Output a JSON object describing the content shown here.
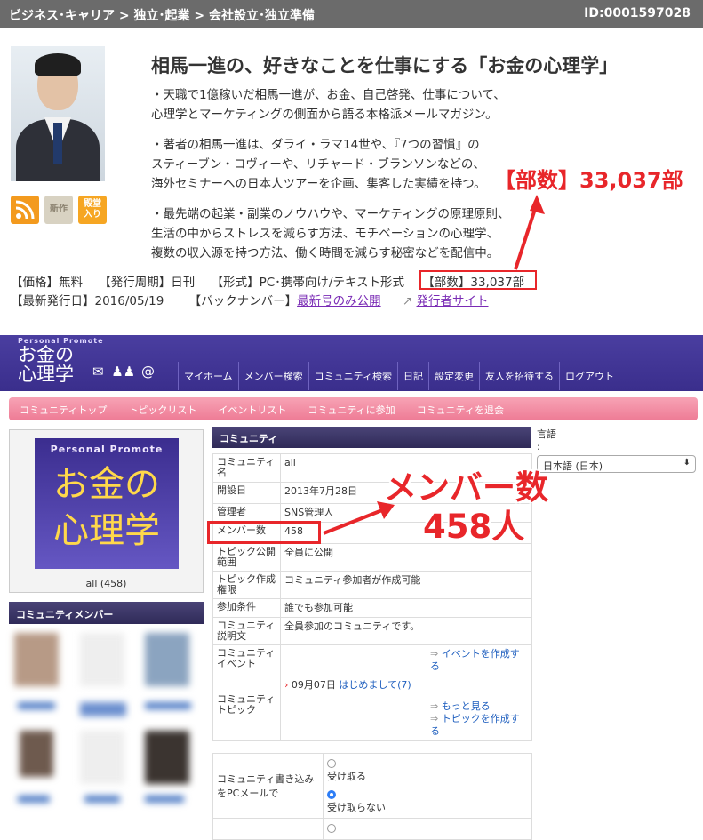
{
  "breadcrumb": {
    "path": "ビジネス･キャリア > 独立･起業 > 会社設立･独立準備",
    "id": "ID:0001597028"
  },
  "magazine": {
    "title": "相馬一進の、好きなことを仕事にする「お金の心理学」",
    "desc1": [
      "・天職で1億稼いだ相馬一進が、お金、自己啓発、仕事について、",
      "心理学とマーケティングの側面から語る本格派メールマガジン。"
    ],
    "desc2": [
      "・著者の相馬一進は、ダライ・ラマ14世や、『7つの習慣』の",
      "スティーブン・コヴィーや、リチャード・ブランソンなどの、",
      "海外セミナーへの日本人ツアーを企画、集客した実績を持つ。"
    ],
    "desc3": [
      "・最先端の起業・副業のノウハウや、マーケティングの原理原則、",
      "生活の中からストレスを減らす方法、モチベーションの心理学、",
      "複数の収入源を持つ方法、働く時間を減らす秘密などを配信中。"
    ],
    "buttons": {
      "new": "新作",
      "subscribe_1": "殿堂",
      "subscribe_2": "入り"
    },
    "highlight": "【部数】33,037部",
    "meta": {
      "price": "【価格】無料",
      "period": "【発行周期】日刊",
      "format": "【形式】PC･携帯向け/テキスト形式",
      "count": "【部数】33,037部",
      "latest": "【最新発行日】2016/05/19",
      "backnum_label": "【バックナンバー】",
      "backnum_link": "最新号のみ公開",
      "publisher_link": "発行者サイト"
    }
  },
  "community": {
    "logo_small": "Personal Promote",
    "logo_1": "お金の",
    "logo_2": "心理学",
    "nav": [
      "マイホーム",
      "メンバー検索",
      "コミュニティ検索",
      "日記",
      "設定変更",
      "友人を招待する",
      "ログアウト"
    ],
    "subnav": [
      "コミュニティトップ",
      "トピックリスト",
      "イベントリスト",
      "コミュニティに参加",
      "コミュニティを退会"
    ],
    "image_small": "Personal Promote",
    "image_1": "お金の",
    "image_2": "心理学",
    "caption": "all (458)",
    "members_header": "コミュニティメンバー",
    "info_header": "コミュニティ",
    "rows": {
      "name_k": "コミュニティ名",
      "name_v": "all",
      "date_k": "開設日",
      "date_v": "2013年7月28日",
      "admin_k": "管理者",
      "admin_v": "SNS管理人",
      "members_k": "メンバー数",
      "members_v": "458",
      "topicpub_k": "トピック公開範囲",
      "topicpub_v": "全員に公開",
      "topiccreate_k": "トピック作成権限",
      "topiccreate_v": "コミュニティ参加者が作成可能",
      "join_k": "参加条件",
      "join_v": "誰でも参加可能",
      "desc_k": "コミュニティ説明文",
      "desc_v": "全員参加のコミュニティです。",
      "event_k": "コミュニティイベント",
      "event_link": "イベントを作成する",
      "topic_k": "コミュニティトピック",
      "topic_date": "09月07日",
      "topic_title": "はじめまして(7)",
      "more": "もっと見る",
      "create_topic": "トピックを作成する"
    },
    "mail_k": "コミュニティ書き込みをPCメールで",
    "receive": "受け取る",
    "not_receive": "受け取らない",
    "lang_label": "言語",
    "lang_value": "日本語 (日本)",
    "annotation_1": "メンバー数",
    "annotation_2": "458人"
  },
  "colors": {
    "accent_red": "#e8262a",
    "header_purple": "#3a2e8c",
    "link_blue": "#1f5fbf",
    "pink_nav": "#ee7b95"
  }
}
